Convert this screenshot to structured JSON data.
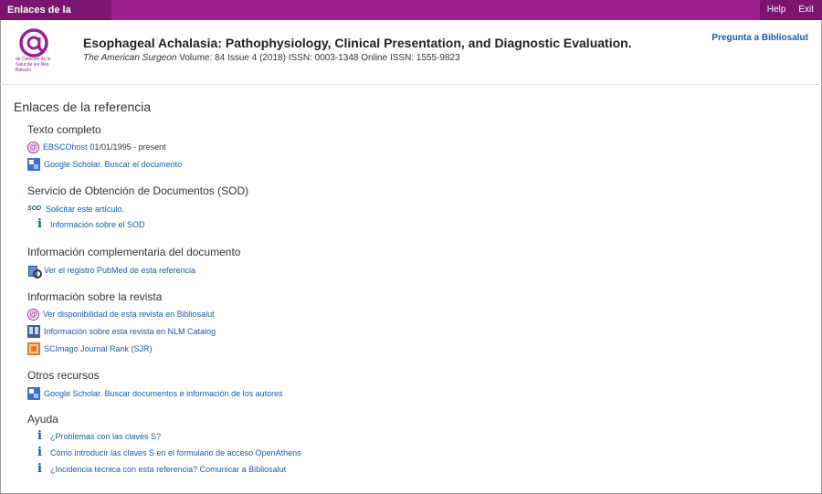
{
  "topbar": {
    "tab_label": "Enlaces de la referencia",
    "help_label": "Help",
    "exit_label": "Exit",
    "color": "#9e1f8e"
  },
  "header": {
    "logo_text": "de Ciències de la Salut de les Illes Balears",
    "article_title": "Esophageal Achalasia: Pathophysiology, Clinical Presentation, and Diagnostic Evaluation.",
    "journal": "The American Surgeon",
    "details": " Volume: 84 Issue 4 (2018) ISSN: 0003-1348 Online ISSN: 1555-9823",
    "ask_link": "Pregunta a Bibliosalut"
  },
  "page_title": "Enlaces de la referencia",
  "sections": [
    {
      "title": "Texto completo",
      "links": [
        {
          "icon": "bibliosalut-icon",
          "label": "EBSCOhost",
          "extra": "01/01/1995 - present"
        },
        {
          "icon": "google-scholar-icon",
          "label": "Google Scholar. Buscar el documento"
        }
      ]
    },
    {
      "title": "Servicio de Obtención de Documentos (SOD)",
      "links": [
        {
          "icon": "sod-icon",
          "label": "Solicitar este artículo."
        },
        {
          "icon": "info-icon",
          "label": "Información sobre el SOD"
        }
      ]
    },
    {
      "title": "Información complementaria del documento",
      "links": [
        {
          "icon": "pubmed-icon",
          "label": "Ver el registro PubMed de esta referencia"
        }
      ]
    },
    {
      "title": "Información sobre la revista",
      "links": [
        {
          "icon": "bibliosalut-icon",
          "label": "Ver disponibilidad de esta revista en Bibliosalut"
        },
        {
          "icon": "nlm-icon",
          "label": "Información sobre esta revista en NLM Catalog"
        },
        {
          "icon": "scimago-icon",
          "label": "SCImago Journal Rank (SJR)"
        }
      ]
    },
    {
      "title": "Otros recursos",
      "links": [
        {
          "icon": "google-scholar-icon",
          "label": "Google Scholar. Buscar documentos e información de los autores"
        }
      ]
    },
    {
      "title": "Ayuda",
      "links": [
        {
          "icon": "info-icon",
          "label": "¿Problemas con las claves S?"
        },
        {
          "icon": "info-icon",
          "label": "Cómo introducir las claves S en el formulario de acceso OpenAthens"
        },
        {
          "icon": "info-icon",
          "label": "¿Incidencia técnica con esta referencia? Comunicar a Bibliosalut"
        }
      ]
    }
  ]
}
